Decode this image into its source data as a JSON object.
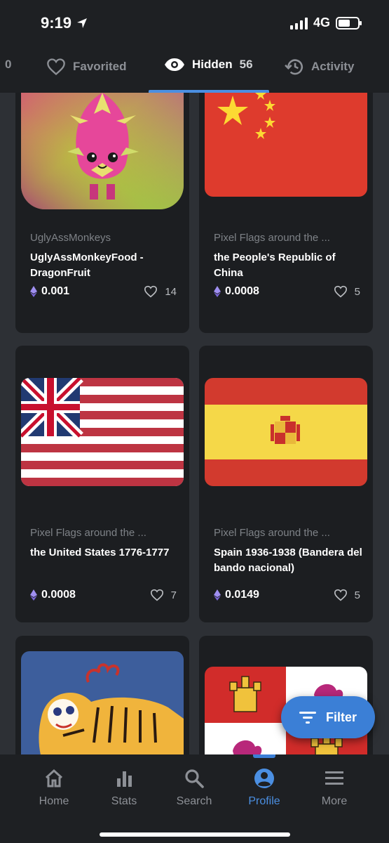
{
  "status_bar": {
    "time": "9:19",
    "network": "4G"
  },
  "tabs": [
    {
      "label": "",
      "count": "0"
    },
    {
      "label": "Favorited",
      "count": ""
    },
    {
      "label": "Hidden",
      "count": "56"
    },
    {
      "label": "Activity",
      "count": ""
    }
  ],
  "cards": [
    {
      "collection": "UglyAssMonkeys",
      "title": "UglyAssMonkeyFood - DragonFruit",
      "price": "0.001",
      "likes": "14"
    },
    {
      "collection": "Pixel Flags around the ...",
      "title": "the People's Republic of China",
      "price": "0.0008",
      "likes": "5"
    },
    {
      "collection": "Pixel Flags around the ...",
      "title": "the United States 1776-1777",
      "price": "0.0008",
      "likes": "7"
    },
    {
      "collection": "Pixel Flags around the ...",
      "title": "Spain 1936-1938 (Bandera del bando nacional)",
      "price": "0.0149",
      "likes": "5"
    }
  ],
  "filter": {
    "label": "Filter"
  },
  "nav": [
    {
      "label": "Home"
    },
    {
      "label": "Stats"
    },
    {
      "label": "Search"
    },
    {
      "label": "Profile"
    },
    {
      "label": "More"
    }
  ],
  "colors": {
    "accent": "#4b8fe2",
    "background": "#2d3035",
    "card": "#1c1e21",
    "eth": "#8f7de8"
  }
}
